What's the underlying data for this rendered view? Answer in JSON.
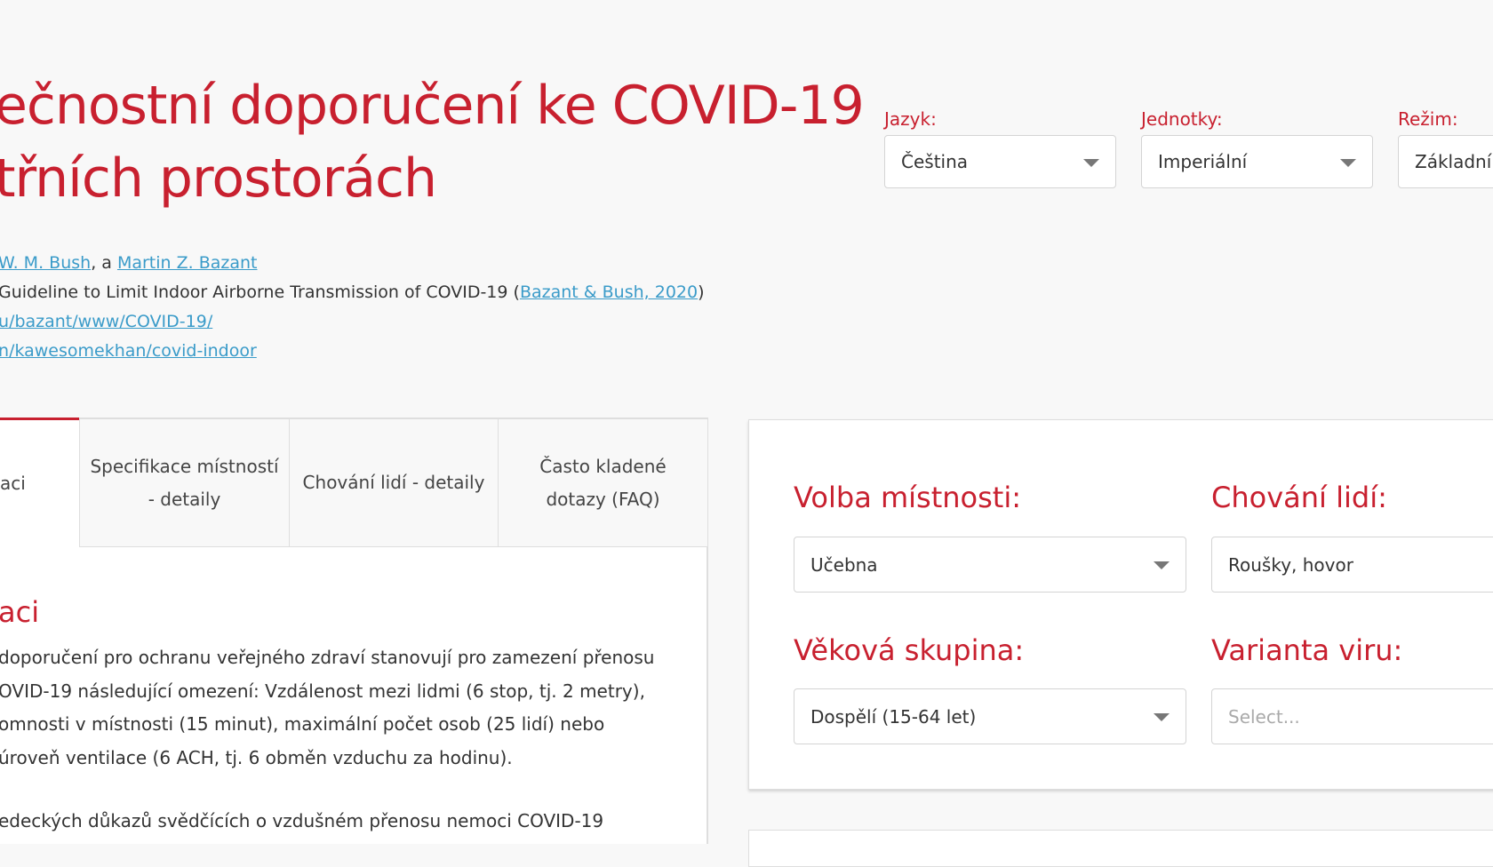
{
  "header": {
    "title_line1": "ečnostní doporučení ke COVID-19",
    "title_line2": "třních prostorách"
  },
  "credits": {
    "line1_author1": "W. M. Bush",
    "line1_sep": ", a ",
    "line1_author2": "Martin Z. Bazant",
    "line2_text": " Guideline to Limit Indoor Airborne Transmission of COVID-19 (",
    "line2_link": "Bazant & Bush, 2020",
    "line2_end": ")",
    "line3_link": "u/bazant/www/COVID-19/",
    "line4_link": "n/kawesomekhan/covid-indoor"
  },
  "settings": {
    "language": {
      "label": "Jazyk:",
      "value": "Čeština"
    },
    "units": {
      "label": "Jednotky:",
      "value": "Imperiální"
    },
    "mode": {
      "label": "Režim:",
      "value": "Základní"
    }
  },
  "tabs": [
    {
      "label": "aci"
    },
    {
      "label": "Specifikace místností - detaily"
    },
    {
      "label": "Chování lidí - detaily"
    },
    {
      "label": "Často kladené dotazy (FAQ)"
    }
  ],
  "content": {
    "section_title": "aci",
    "paragraph1": "doporučení pro ochranu veřejného zdraví stanovují pro zamezení přenosu OVID-19 následující omezení: Vzdálenost mezi lidmi (6 stop, tj. 2 metry), omnosti v místnosti (15 minut), maximální počet osob (25 lidí) nebo úroveň ventilace (6 ACH, tj. 6 obměn vzduchu za hodinu).",
    "paragraph2": "edeckých důkazů svědčících o vzdušném přenosu nemoci COVID-19"
  },
  "form": {
    "room": {
      "label": "Volba místnosti:",
      "value": "Učebna"
    },
    "behavior": {
      "label": "Chování lidí:",
      "value": "Roušky, hovor"
    },
    "age": {
      "label": "Věková skupina:",
      "value": "Dospělí (15-64 let)"
    },
    "variant": {
      "label": "Varianta viru:",
      "placeholder": "Select..."
    }
  },
  "colors": {
    "accent": "#c8202f",
    "link": "#3a9bc9"
  }
}
